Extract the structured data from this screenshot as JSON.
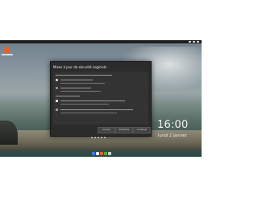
{
  "dialog": {
    "title": "Mises à jour de sécurité Logiciels",
    "buttons": [
      "Annuler",
      "Précédent",
      "Continuer"
    ]
  },
  "clock": {
    "time": "16:00",
    "date": "lundi 2 janvier"
  },
  "colors": {
    "dialog_bg": "#2b2b2b",
    "logo": "#e2622b",
    "taskbar": "#1e1e1e"
  },
  "icons": [
    "ubuntu-logo-icon",
    "tray-icons",
    "dock-app-icons"
  ]
}
